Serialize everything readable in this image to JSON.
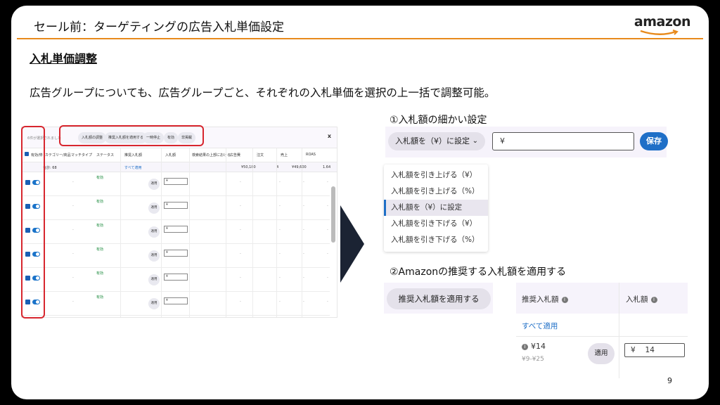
{
  "slide": {
    "title": "セール前：ターゲティングの広告入札単価設定",
    "logo": "amazon",
    "section": "入札単価調整",
    "description": "広告グループについても、広告グループごと、それぞれの入札単価を選択の上一括で調整可能。",
    "page_number": "9"
  },
  "table_shot": {
    "selected_text": "6件が選択されました",
    "toolbar": [
      "入札額の調整",
      "推奨入札額を適用する",
      "一時停止",
      "有効",
      "非掲載"
    ],
    "close": "x",
    "headers": [
      "有効/停",
      "カテゴリー/商品",
      "マッチタイプ",
      "ステータス",
      "推奨入札額",
      "入札額",
      "検索結果の上部における",
      "広告費",
      "注文",
      "売上",
      "ROAS"
    ],
    "totals": {
      "label": "合計: 68",
      "apply_all": "すべて適用",
      "spend": "¥50,180",
      "orders": "4",
      "sales": "¥49,600",
      "roas": "1.64"
    },
    "rows": [
      {
        "status": "有効",
        "apply": "適用",
        "bid": "¥"
      },
      {
        "status": "有効",
        "apply": "適用",
        "bid": "¥"
      },
      {
        "status": "有効",
        "apply": "適用",
        "bid": "¥"
      },
      {
        "status": "有効",
        "apply": "適用",
        "bid": "¥"
      },
      {
        "status": "有効",
        "apply": "適用",
        "bid": "¥"
      },
      {
        "status": "有効",
        "apply": "適用",
        "bid": "¥"
      }
    ]
  },
  "panel1": {
    "title": "①入札額の細かい設定",
    "dropdown": "入札額を（¥）に設定",
    "input": "¥",
    "save": "保存",
    "menu": [
      "入札額を引き上げる（¥）",
      "入札額を引き上げる（%）",
      "入札額を（¥）に設定",
      "入札額を引き下げる（¥）",
      "入札額を引き下げる（%）"
    ],
    "menu_active_index": 2
  },
  "panel2": {
    "title": "②Amazonの推奨する入札額を適用する",
    "apply_button": "推奨入札額を適用する",
    "col_recommended": "推奨入札額",
    "col_bid": "入札額",
    "apply_all": "すべて適用",
    "rec_value": "¥14",
    "rec_range": "¥9-¥25",
    "use_button": "適用",
    "bid_value": "¥　 14"
  },
  "colors": {
    "accent_orange": "#e88a1c",
    "highlight_red": "#d7262e",
    "primary_blue": "#1f6fc7",
    "arrow": "#1b2333"
  }
}
